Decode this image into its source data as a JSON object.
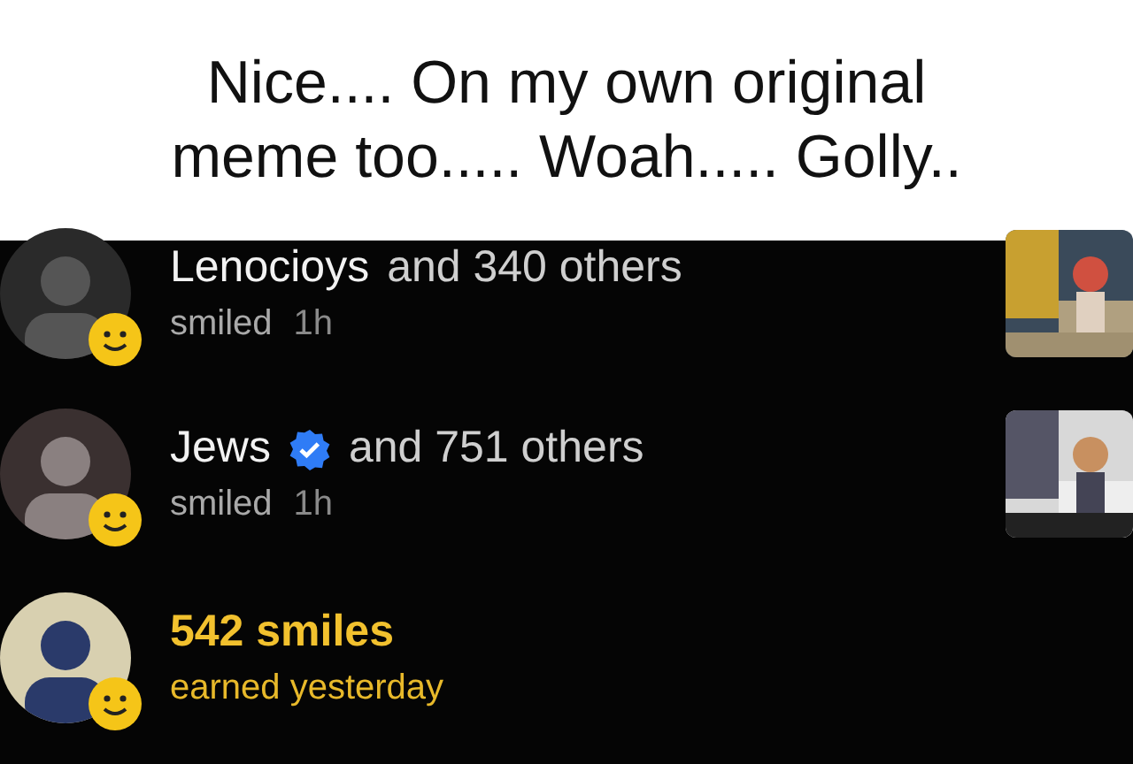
{
  "caption": "Nice.... On my own original meme too..... Woah..... Golly..",
  "notifications": [
    {
      "kind": "smile",
      "name": "Lenocioys",
      "verified": false,
      "others": "and 340 others",
      "action": "smiled",
      "time": "1h",
      "thumbnail": true
    },
    {
      "kind": "smile",
      "name": "Jews",
      "verified": true,
      "others": "and 751 others",
      "action": "smiled",
      "time": "1h",
      "thumbnail": true
    },
    {
      "kind": "milestone",
      "title": "542 smiles",
      "subtitle": "earned yesterday",
      "thumbnail": false
    }
  ]
}
